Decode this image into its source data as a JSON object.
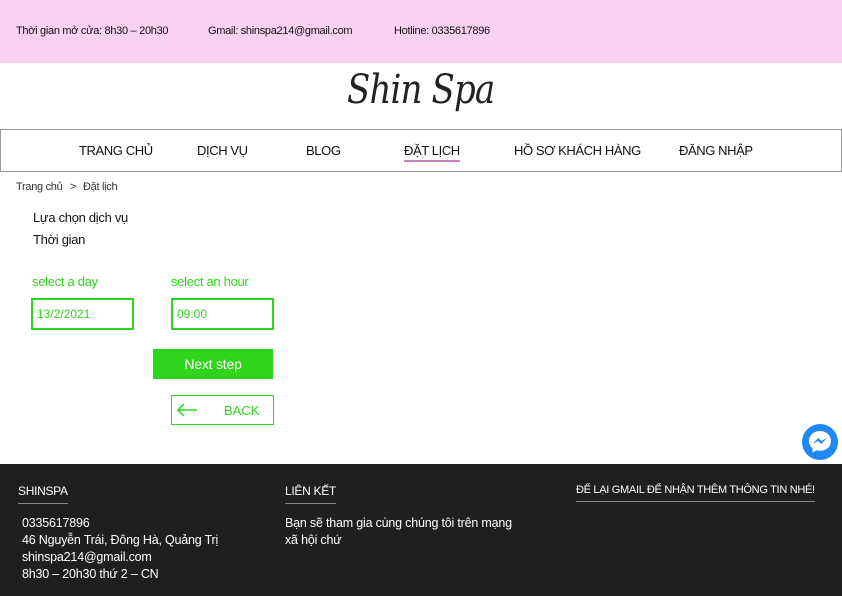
{
  "topbar": {
    "hours": "Thời gian mở cửa: 8h30 – 20h30",
    "email": "Gmail: shinspa214@gmail.com",
    "hotline": "Hotline: 0335617896"
  },
  "logo": {
    "text": "Shin Spa"
  },
  "nav": {
    "items": [
      {
        "label": "TRANG CHỦ"
      },
      {
        "label": "DỊCH VỤ"
      },
      {
        "label": "BLOG"
      },
      {
        "label": "ĐẶT LỊCH"
      },
      {
        "label": "HỒ SƠ KHÁCH HÀNG"
      },
      {
        "label": "ĐĂNG NHẬP"
      }
    ],
    "active": "ĐẶT LỊCH"
  },
  "breadcrumb": {
    "home": "Trang chủ",
    "separator": ">",
    "current": "Đặt lịch"
  },
  "booking": {
    "choose_service": "Lựa chọn dịch vụ",
    "time_label": "Thời gian",
    "day_label": "select a day",
    "day_value": "13/2/2021",
    "hour_label": "select an hour",
    "hour_value": "09:00",
    "next_label": "Next step",
    "back_label": "BACK"
  },
  "footer": {
    "col1": {
      "title": "SHINSPA",
      "phone": "0335617896",
      "address": "46 Nguyễn Trái, Đông Hà, Quảng Trị",
      "email": "shinspa214@gmail.com",
      "hours": "8h30 – 20h30 thứ 2 – CN"
    },
    "col2": {
      "title": "LIÊN KẾT",
      "line1": "Bạn sẽ tham gia cùng chúng tôi trên mạng",
      "line2": "xã hội chứ"
    },
    "col3": {
      "title": "ĐỂ LẠI GMAIL ĐỂ NHẬN THÊM THÔNG TIN NHÉ!"
    }
  },
  "colors": {
    "topbar": "#f8d2f0",
    "accent_green": "#2fd51c",
    "footer_bg": "#1d1f21",
    "active_underline": "#c77fc0",
    "messenger": "#1e88f5"
  },
  "icons": {
    "back": "arrow-left-icon",
    "chat": "messenger-icon"
  }
}
